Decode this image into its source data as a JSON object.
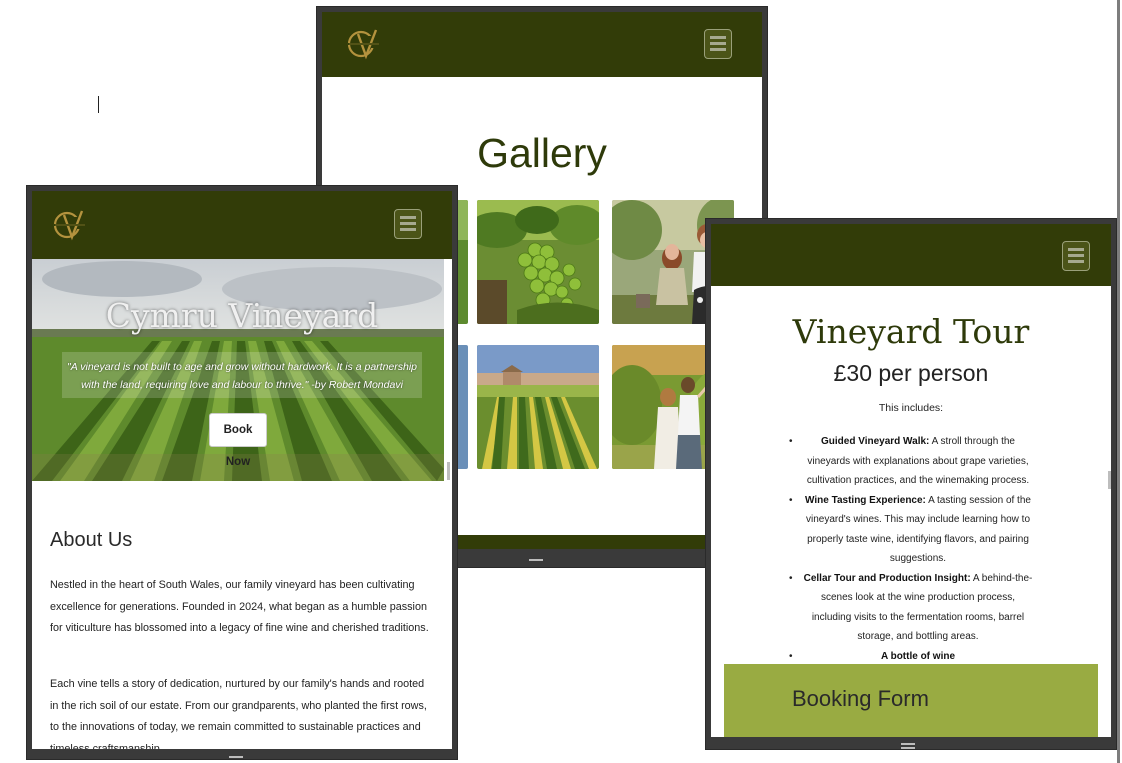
{
  "gallery_page": {
    "title": "Gallery",
    "images": [
      {
        "name": "grape-cluster-photo"
      },
      {
        "name": "couple-picnic-wine-photo"
      },
      {
        "name": "vineyard-rows-house-photo"
      },
      {
        "name": "couple-in-vineyard-photo"
      }
    ]
  },
  "tour_page": {
    "title": "Vineyard Tour",
    "price": "£30 per person",
    "includes_label": "This includes:",
    "items": [
      {
        "heading": "Guided Vineyard Walk:",
        "text": " A stroll through the vineyards with explanations about grape varieties, cultivation practices, and the winemaking process."
      },
      {
        "heading": "Wine Tasting Experience:",
        "text": " A tasting session of the vineyard's wines. This may include learning how to properly taste wine, identifying flavors, and pairing suggestions."
      },
      {
        "heading": "Cellar Tour and Production Insight:",
        "text": " A behind-the-scenes look at the wine production process, including visits to the fermentation rooms, barrel storage, and bottling areas."
      },
      {
        "heading": "A bottle of wine",
        "text": ""
      }
    ],
    "booking_title": "Booking Form"
  },
  "home_page": {
    "hero_title": "Cymru Vineyard",
    "hero_quote": "\"A vineyard is not built to age and grow without hardwork. It is a partnership with the land, requiring love and labour to thrive.\" -by Robert Mondavi",
    "book_button": "Book Now",
    "about_title": "About Us",
    "about_p1": "Nestled in the heart of South Wales, our family vineyard has been cultivating excellence for generations. Founded in 2024, what began as a humble passion for viticulture has blossomed into a legacy of fine wine and cherished traditions.",
    "about_p2": "Each vine tells a story of dedication, nurtured by our family's hands and rooted in the rich soil of our estate. From our grandparents, who planted the first rows, to the innovations of today, we remain committed to sustainable practices and timeless craftsmanship."
  },
  "colors": {
    "header": "#323c08",
    "booking_band": "#99ab42",
    "logo_gold": "#b4933e"
  }
}
